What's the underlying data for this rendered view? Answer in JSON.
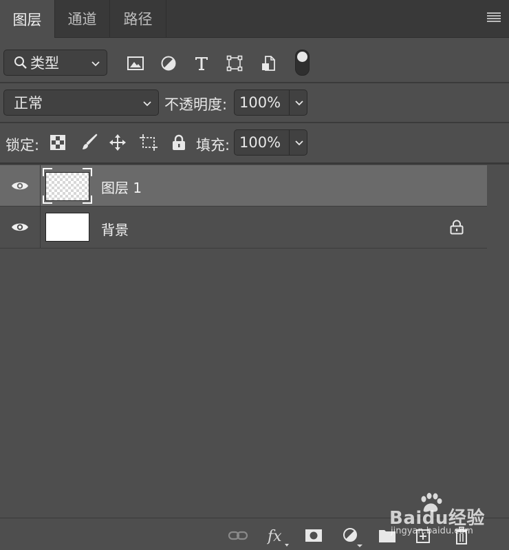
{
  "tabs": [
    {
      "label": "图层",
      "active": true
    },
    {
      "label": "通道",
      "active": false
    },
    {
      "label": "路径",
      "active": false
    }
  ],
  "filter": {
    "label": "类型"
  },
  "blend": {
    "mode": "正常",
    "opacity_label": "不透明度:",
    "opacity_value": "100%"
  },
  "lock": {
    "label": "锁定:",
    "fill_label": "填充:",
    "fill_value": "100%"
  },
  "layers": [
    {
      "name": "图层 1",
      "selected": true,
      "visible": true,
      "locked": false,
      "thumbnail": "transparent"
    },
    {
      "name": "背景",
      "selected": false,
      "visible": true,
      "locked": true,
      "thumbnail": "white"
    }
  ],
  "watermark": {
    "brand": "Baidu经验",
    "url": "jingyan.baidu.com"
  },
  "colors": {
    "panel": "#4e4e4e",
    "tabbar": "#393939",
    "selected_row": "#6a6a6a",
    "field": "#414141"
  }
}
